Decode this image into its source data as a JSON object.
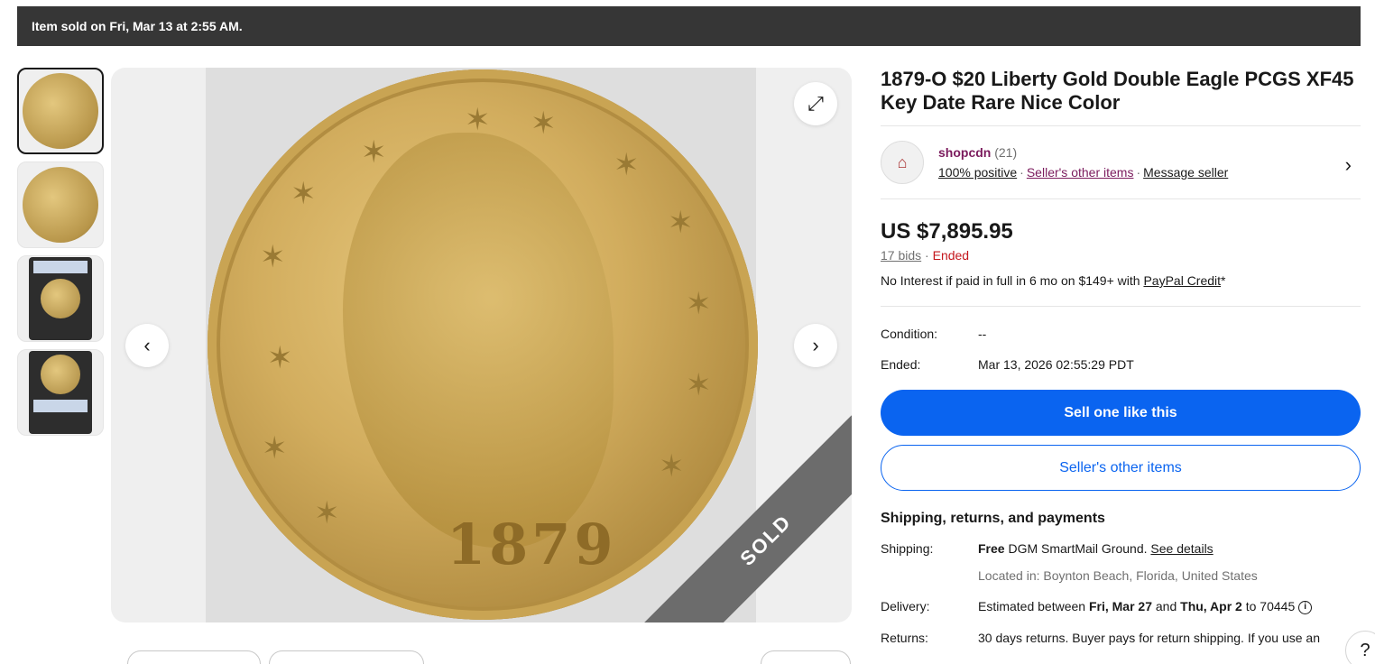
{
  "banner": {
    "text": "Item sold on Fri, Mar 13 at 2:55 AM."
  },
  "gallery": {
    "thumbnails": [
      "coin-obverse",
      "coin-reverse",
      "slab-front",
      "slab-back"
    ],
    "main_year": "1879",
    "sold_label": "SOLD",
    "expand_icon": "expand-icon",
    "prev_icon": "‹",
    "next_icon": "›",
    "expand_glyph": "⤢"
  },
  "item": {
    "title": "1879-O $20 Liberty Gold Double Eagle PCGS XF45 Key Date Rare Nice Color"
  },
  "seller": {
    "name": "shopcdn",
    "feedback_count": "(21)",
    "positive": "100% positive",
    "other_items": "Seller's other items",
    "message": "Message seller",
    "separator": "·",
    "chevron": "›"
  },
  "price": {
    "amount": "US $7,895.95",
    "bids": "17 bids",
    "status": "Ended",
    "credit_prefix": "No Interest if paid in full in 6 mo on $149+ with ",
    "credit_link": "PayPal Credit",
    "credit_suffix": "*"
  },
  "details": {
    "condition_label": "Condition:",
    "condition_value": "--",
    "ended_label": "Ended:",
    "ended_value": "Mar 13, 2026 02:55:29 PDT"
  },
  "actions": {
    "sell": "Sell one like this",
    "other_items": "Seller's other items"
  },
  "shipping": {
    "heading": "Shipping, returns, and payments",
    "shipping_label": "Shipping:",
    "free": "Free",
    "method": " DGM SmartMail Ground. ",
    "see_details": "See details",
    "located": "Located in: Boynton Beach, Florida, United States",
    "delivery_label": "Delivery:",
    "delivery_prefix": "Estimated between ",
    "delivery_from": "Fri, Mar 27",
    "delivery_and": " and ",
    "delivery_to": "Thu, Apr 2",
    "delivery_zip": " to 70445 ",
    "returns_label": "Returns:",
    "returns_value": "30 days returns. Buyer pays for return shipping. If you use an"
  },
  "help": {
    "label": "?"
  },
  "colors": {
    "primary": "#0a64f0",
    "seller": "#7b1b5d",
    "ended": "#c4161c",
    "banner": "#363636"
  }
}
